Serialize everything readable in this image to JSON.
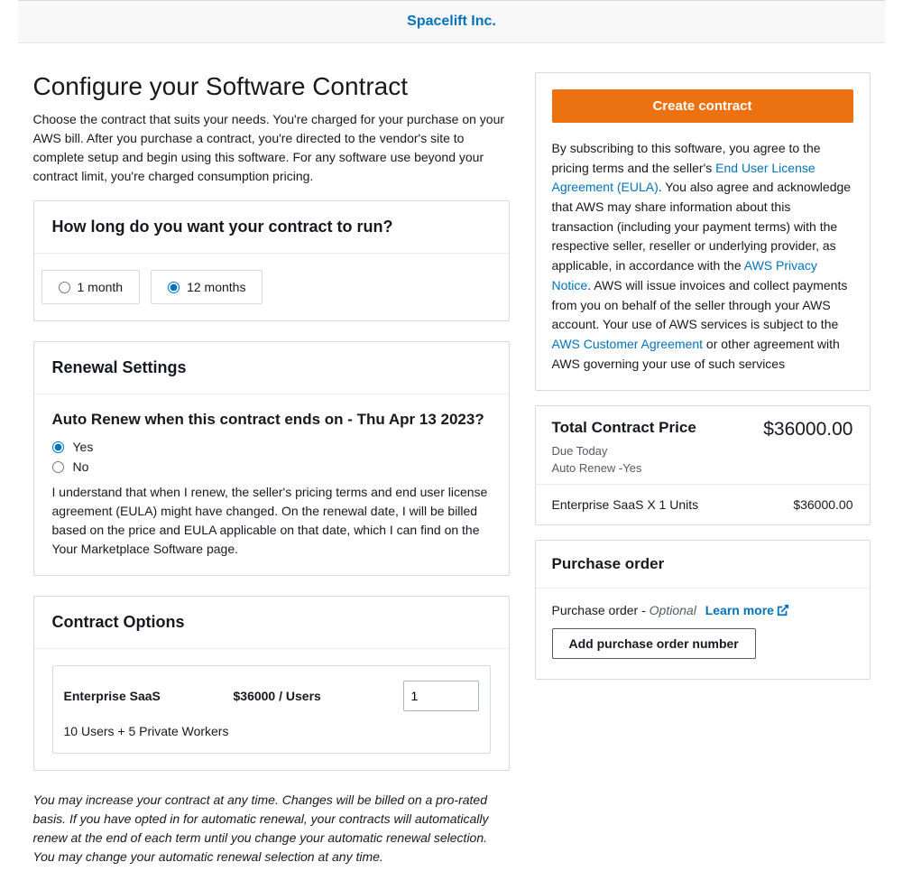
{
  "vendor_link": "Spacelift Inc.",
  "heading": "Configure your Software Contract",
  "intro": "Choose the contract that suits your needs. You're charged for your purchase on your AWS bill. After you purchase a contract, you're directed to the vendor's site to complete setup and begin using this software. For any software use beyond your contract limit, you're charged consumption pricing.",
  "duration": {
    "title": "How long do you want your contract to run?",
    "options": [
      {
        "label": "1 month",
        "checked": false
      },
      {
        "label": "12 months",
        "checked": true
      }
    ]
  },
  "renewal": {
    "title": "Renewal Settings",
    "question": "Auto Renew when this contract ends on - Thu Apr 13 2023?",
    "yes_label": "Yes",
    "no_label": "No",
    "note": "I understand that when I renew, the seller's pricing terms and end user license agreement (EULA) might have changed. On the renewal date, I will be billed based on the price and EULA applicable on that date, which I can find on the Your Marketplace Software page."
  },
  "options": {
    "title": "Contract Options",
    "item_name": "Enterprise SaaS",
    "item_price": "$36000 / Users",
    "item_qty": "1",
    "item_desc": "10 Users + 5 Private Workers"
  },
  "footer_note": "You may increase your contract at any time. Changes will be billed on a pro-rated basis. If you have opted in for automatic renewal, your contracts will automatically renew at the end of each term until you change your automatic renewal selection. You may change your automatic renewal selection at any time.",
  "create_button": "Create contract",
  "subscribe": {
    "part1": "By subscribing to this software, you agree to the pricing terms and the seller's ",
    "eula_link": "End User License Agreement (EULA)",
    "part2": ". You also agree and acknowledge that AWS may share information about this transaction (including your payment terms) with the respective seller, reseller or underlying provider, as applicable, in accordance with the ",
    "privacy_link": "AWS Privacy Notice",
    "part3": ". AWS will issue invoices and collect payments from you on behalf of the seller through your AWS account. Your use of AWS services is subject to the ",
    "customer_link": "AWS Customer Agreement",
    "part4": " or other agreement with AWS governing your use of such services"
  },
  "price": {
    "title": "Total Contract Price",
    "amount": "$36000.00",
    "due_today": "Due Today",
    "auto_renew": "Auto Renew -Yes",
    "line_item_label": "Enterprise SaaS X 1 Units",
    "line_item_amount": "$36000.00"
  },
  "po": {
    "title": "Purchase order",
    "label": "Purchase order - ",
    "optional": "Optional",
    "learn_more": "Learn more",
    "add_button": "Add purchase order number"
  }
}
